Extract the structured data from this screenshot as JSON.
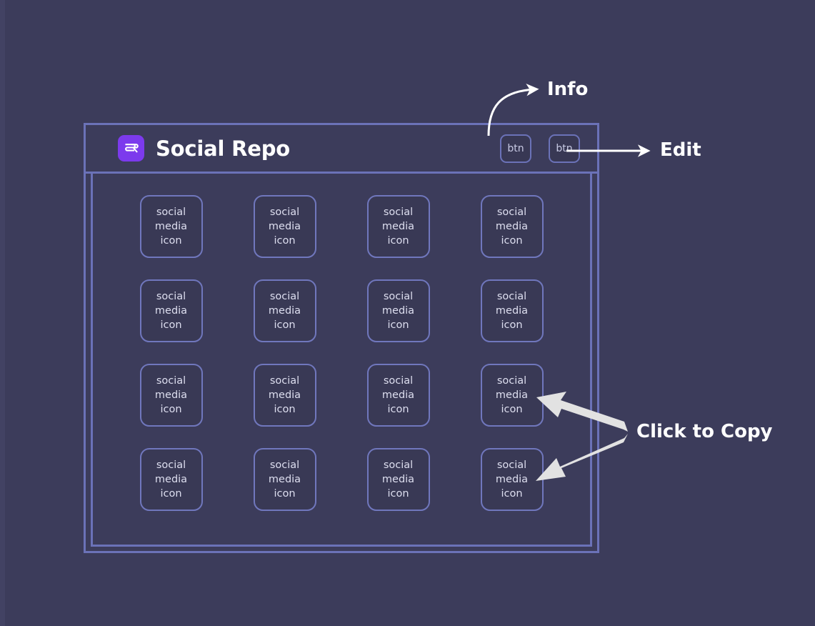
{
  "app": {
    "title": "Social Repo",
    "logo_icon": "sr-monogram-logo",
    "logo_color": "#7c3aed",
    "frame_border_color": "#6b72b8",
    "background_color": "#3c3c5b"
  },
  "header": {
    "buttons": [
      {
        "label": "btn",
        "name": "info-button"
      },
      {
        "label": "btn",
        "name": "edit-button"
      }
    ]
  },
  "grid": {
    "rows": 4,
    "columns": 4,
    "card_label_lines": [
      "social",
      "media",
      "icon"
    ],
    "cards": [
      {
        "line1": "social",
        "line2": "media",
        "line3": "icon"
      },
      {
        "line1": "social",
        "line2": "media",
        "line3": "icon"
      },
      {
        "line1": "social",
        "line2": "media",
        "line3": "icon"
      },
      {
        "line1": "social",
        "line2": "media",
        "line3": "icon"
      },
      {
        "line1": "social",
        "line2": "media",
        "line3": "icon"
      },
      {
        "line1": "social",
        "line2": "media",
        "line3": "icon"
      },
      {
        "line1": "social",
        "line2": "media",
        "line3": "icon"
      },
      {
        "line1": "social",
        "line2": "media",
        "line3": "icon"
      },
      {
        "line1": "social",
        "line2": "media",
        "line3": "icon"
      },
      {
        "line1": "social",
        "line2": "media",
        "line3": "icon"
      },
      {
        "line1": "social",
        "line2": "media",
        "line3": "icon"
      },
      {
        "line1": "social",
        "line2": "media",
        "line3": "icon"
      },
      {
        "line1": "social",
        "line2": "media",
        "line3": "icon"
      },
      {
        "line1": "social",
        "line2": "media",
        "line3": "icon"
      },
      {
        "line1": "social",
        "line2": "media",
        "line3": "icon"
      },
      {
        "line1": "social",
        "line2": "media",
        "line3": "icon"
      }
    ]
  },
  "annotations": {
    "info": "Info",
    "edit": "Edit",
    "copy": "Click to Copy",
    "arrow_color": "#ffffff",
    "copy_arrow_color": "#e2e2e2"
  }
}
